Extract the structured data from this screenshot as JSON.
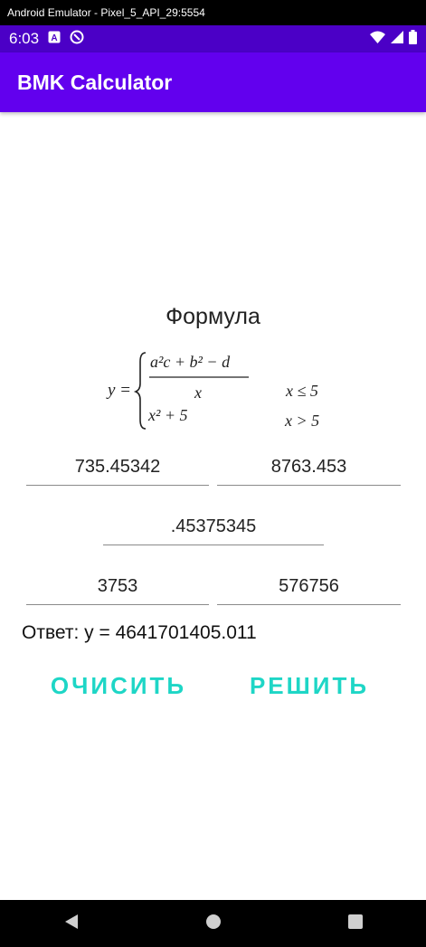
{
  "emulator": {
    "title": "Android Emulator - Pixel_5_API_29:5554"
  },
  "status_bar": {
    "time": "6:03",
    "left_icons": [
      "notification-a-icon",
      "sync-icon"
    ],
    "right_icons": [
      "wifi-icon",
      "signal-icon",
      "battery-icon"
    ],
    "color": "#4b00c6"
  },
  "app_bar": {
    "title": "BMK Calculator",
    "color": "#6200ee"
  },
  "formula": {
    "heading": "Формула",
    "expression": {
      "lhs": "y =",
      "case1_numerator": "a²c + b² − d",
      "case1_denominator": "x",
      "case1_condition": "x ≤ 5",
      "case2": "x² + 5",
      "case2_condition": "x > 5"
    }
  },
  "inputs": {
    "a": "735.45342",
    "b": "8763.453",
    "c": ".45375345",
    "d": "3753",
    "x": "576756"
  },
  "answer": {
    "text": "Ответ: y = 4641701405.011"
  },
  "buttons": {
    "clear_label": "ОЧИСИТЬ",
    "solve_label": "РЕШИТЬ",
    "accent_color": "#1ed6c6"
  },
  "nav_bar": {
    "icons": [
      "back-icon",
      "home-icon",
      "recents-icon"
    ]
  }
}
